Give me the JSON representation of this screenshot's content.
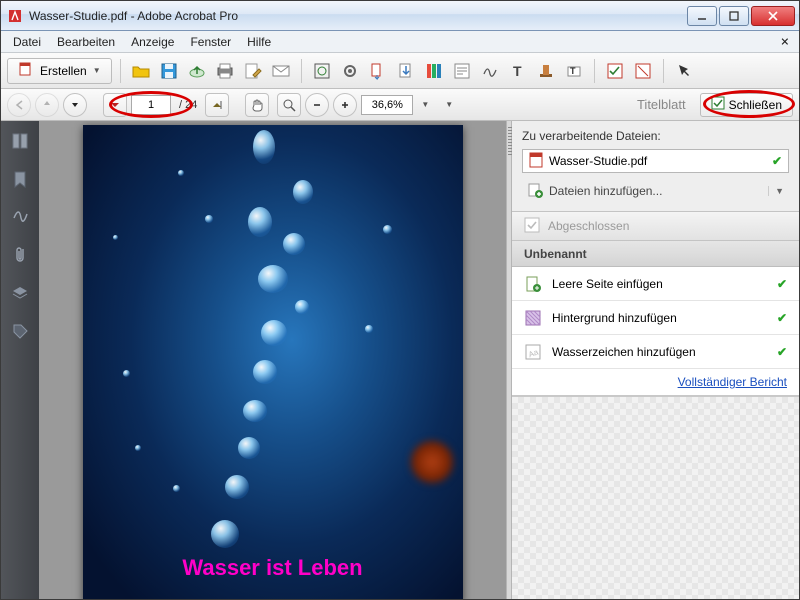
{
  "window": {
    "title": "Wasser-Studie.pdf - Adobe Acrobat Pro"
  },
  "menubar": {
    "file": "Datei",
    "edit": "Bearbeiten",
    "view": "Anzeige",
    "window": "Fenster",
    "help": "Hilfe"
  },
  "toolbar": {
    "create": "Erstellen"
  },
  "nav": {
    "page_current": "1",
    "page_total": "24",
    "zoom": "36,6%",
    "section": "Titelblatt",
    "close": "Schließen"
  },
  "document": {
    "watermark": "Wasser ist Leben"
  },
  "panel": {
    "files_header": "Zu verarbeitende Dateien:",
    "filename": "Wasser-Studie.pdf",
    "add_files": "Dateien hinzufügen...",
    "status_done": "Abgeschlossen",
    "section_title": "Unbenannt",
    "actions": [
      {
        "label": "Leere Seite einfügen"
      },
      {
        "label": "Hintergrund hinzufügen"
      },
      {
        "label": "Wasserzeichen hinzufügen"
      }
    ],
    "report_link": "Vollständiger Bericht"
  }
}
